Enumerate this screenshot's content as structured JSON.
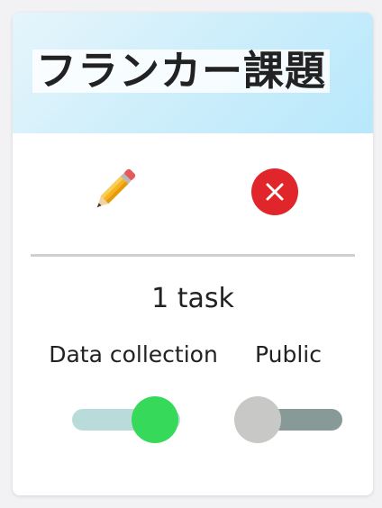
{
  "card": {
    "title": "フランカー課題",
    "edit_icon": "pencil-icon",
    "delete_icon": "close-circle-icon",
    "task_count": "1 task",
    "toggles": [
      {
        "label": "Data collection",
        "on": true
      },
      {
        "label": "Public",
        "on": false
      }
    ]
  },
  "colors": {
    "header_gradient_start": "#e6f5fb",
    "header_gradient_end": "#b8e8fb",
    "delete": "#e0262b",
    "toggle_on_thumb": "#37d95a",
    "toggle_on_track": "#b9dcdb",
    "toggle_off_thumb": "#c8c8c6",
    "toggle_off_track": "#879a97",
    "divider": "#cfcfcf"
  }
}
